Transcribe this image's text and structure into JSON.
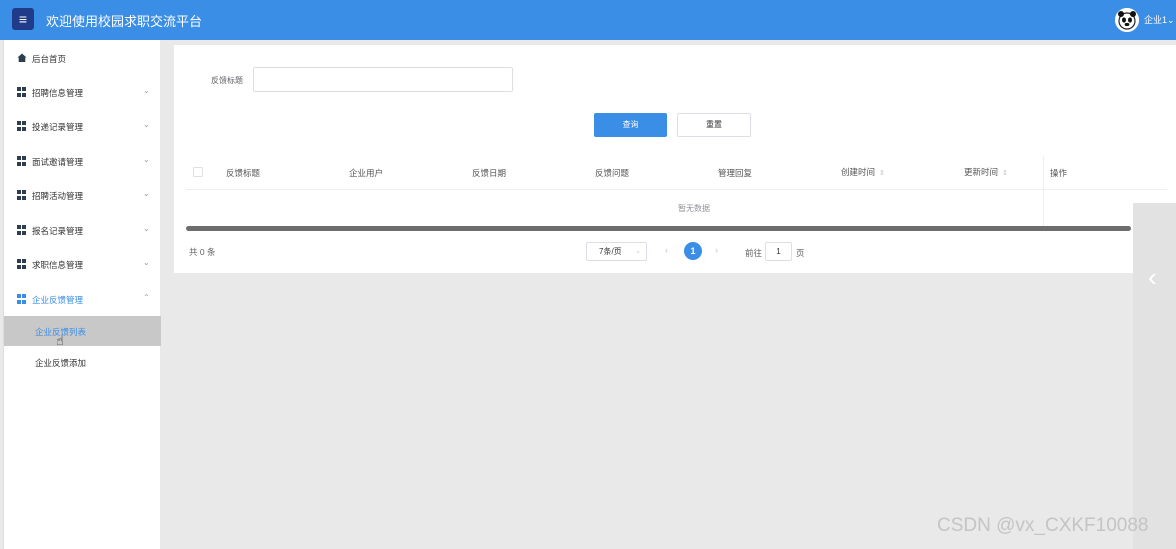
{
  "header": {
    "title": "欢迎使用校园求职交流平台",
    "user": "企业1",
    "menu_icon": "hamburger-icon"
  },
  "sidebar": {
    "home": "后台首页",
    "groups": [
      {
        "label": "招聘信息管理",
        "expanded": false
      },
      {
        "label": "投递记录管理",
        "expanded": false
      },
      {
        "label": "面试邀请管理",
        "expanded": false
      },
      {
        "label": "招聘活动管理",
        "expanded": false
      },
      {
        "label": "报名记录管理",
        "expanded": false
      },
      {
        "label": "求职信息管理",
        "expanded": false
      },
      {
        "label": "企业反馈管理",
        "expanded": true
      }
    ],
    "subitems": [
      {
        "label": "企业反馈列表",
        "selected": true
      },
      {
        "label": "企业反馈添加",
        "selected": false
      }
    ]
  },
  "filter": {
    "label": "反馈标题",
    "value": "",
    "placeholder": "",
    "query_button": "查询",
    "reset_button": "重置"
  },
  "table": {
    "columns": [
      "反馈标题",
      "企业用户",
      "反馈日期",
      "反馈问题",
      "管理回复",
      "创建时间",
      "更新时间",
      "操作"
    ],
    "empty_text": "暂无数据"
  },
  "pagination": {
    "total": "共 0 条",
    "page_size": "7条/页",
    "current_page": "1",
    "goto_label": "前往",
    "goto_value": "1",
    "goto_suffix": "页"
  },
  "watermark": "CSDN @vx_CXKF10088",
  "colors": {
    "header_bg": "#3a8ee6",
    "accent": "#3a8ee6",
    "selected_bg": "#c8c8c8"
  }
}
